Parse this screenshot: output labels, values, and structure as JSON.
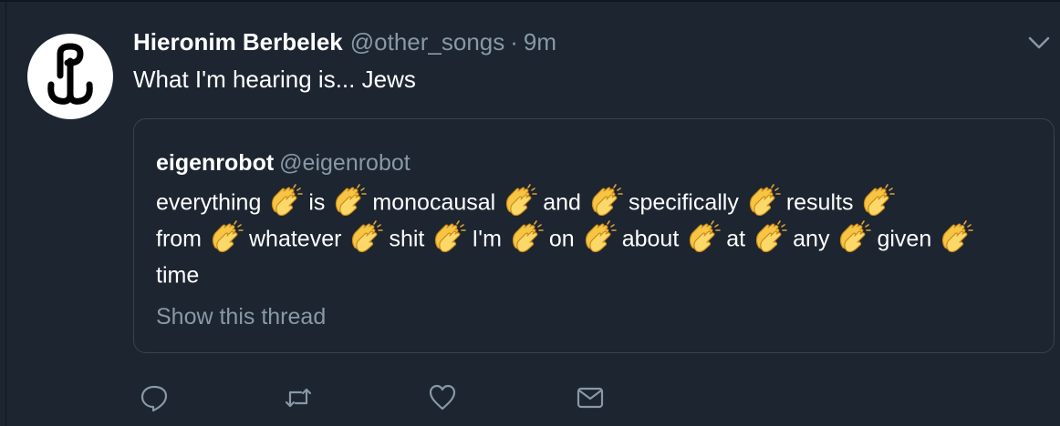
{
  "tweet": {
    "display_name": "Hieronim Berbelek",
    "handle": "@other_songs",
    "separator": "·",
    "time": "9m",
    "text": "What I'm hearing is... Jews"
  },
  "quoted_tweet": {
    "display_name": "eigenrobot",
    "handle": "@eigenrobot",
    "emoji_icon": "clapping-hands-icon",
    "lines": [
      [
        "everything",
        "is",
        "monocausal",
        "and",
        "specifically",
        "results"
      ],
      [
        "from",
        "whatever",
        "shit",
        "I'm",
        "on",
        "about",
        "at",
        "any",
        "given"
      ],
      [
        "time"
      ]
    ],
    "show_thread": "Show this thread"
  },
  "actions": [
    "reply-icon",
    "retweet-icon",
    "like-icon",
    "message-icon"
  ],
  "colors": {
    "background": "#1c2530",
    "secondary_text": "#8899a6",
    "border": "#38444d",
    "clap": "#f6c544"
  }
}
